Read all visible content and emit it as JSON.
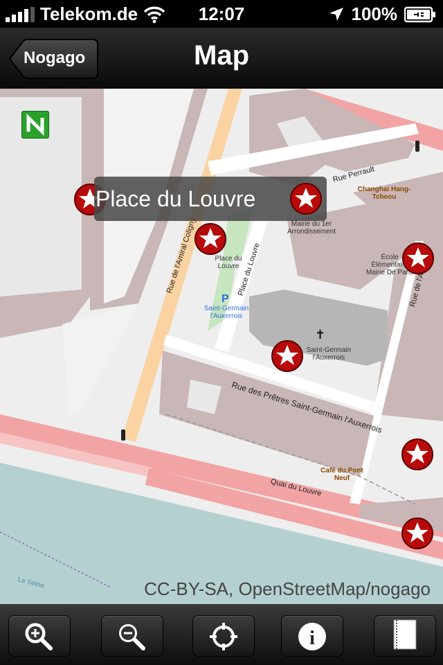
{
  "status": {
    "carrier": "Telekom.de",
    "time": "12:07",
    "battery": "100%"
  },
  "nav": {
    "title": "Map",
    "back_label": "Nogago"
  },
  "map": {
    "callout_title": "Place du Louvre",
    "attribution": "CC-BY-SA, OpenStreetMap/nogago",
    "streets": {
      "amiral": "Rue de l'Amiral Coligny",
      "pretres": "Rue des Prêtres Saint-Germain l'Auxerrois",
      "perrault": "Rue Perrault",
      "quai": "Quai du Louvre",
      "place_louvre_street": "Place du Louvre",
      "arbre": "Rue de l'Arbre",
      "seine": "La Seine"
    },
    "pois": {
      "place_du_louvre": "Place du Louvre",
      "parking": "Saint-Germain l'Auxerrois",
      "church": "Saint-Germain l'Auxerrois",
      "mairie": "Mairie du 1er Arrondissement",
      "ecole": "École Élémentaire Mairie De Paris",
      "changhai": "Changhai Hang-Tcheou",
      "cafe": "Café du Pont Neuf"
    }
  },
  "toolbar": {
    "zoom_in": "zoom-in",
    "zoom_out": "zoom-out",
    "locate": "locate",
    "info": "info",
    "notes": "notes"
  },
  "colors": {
    "road_major": "#f2a4a4",
    "road_secondary": "#fbd3a2",
    "building": "#c9b6b6",
    "water": "#b5d0d0",
    "green": "#c7e6c0",
    "pin": "#b80a0a"
  }
}
